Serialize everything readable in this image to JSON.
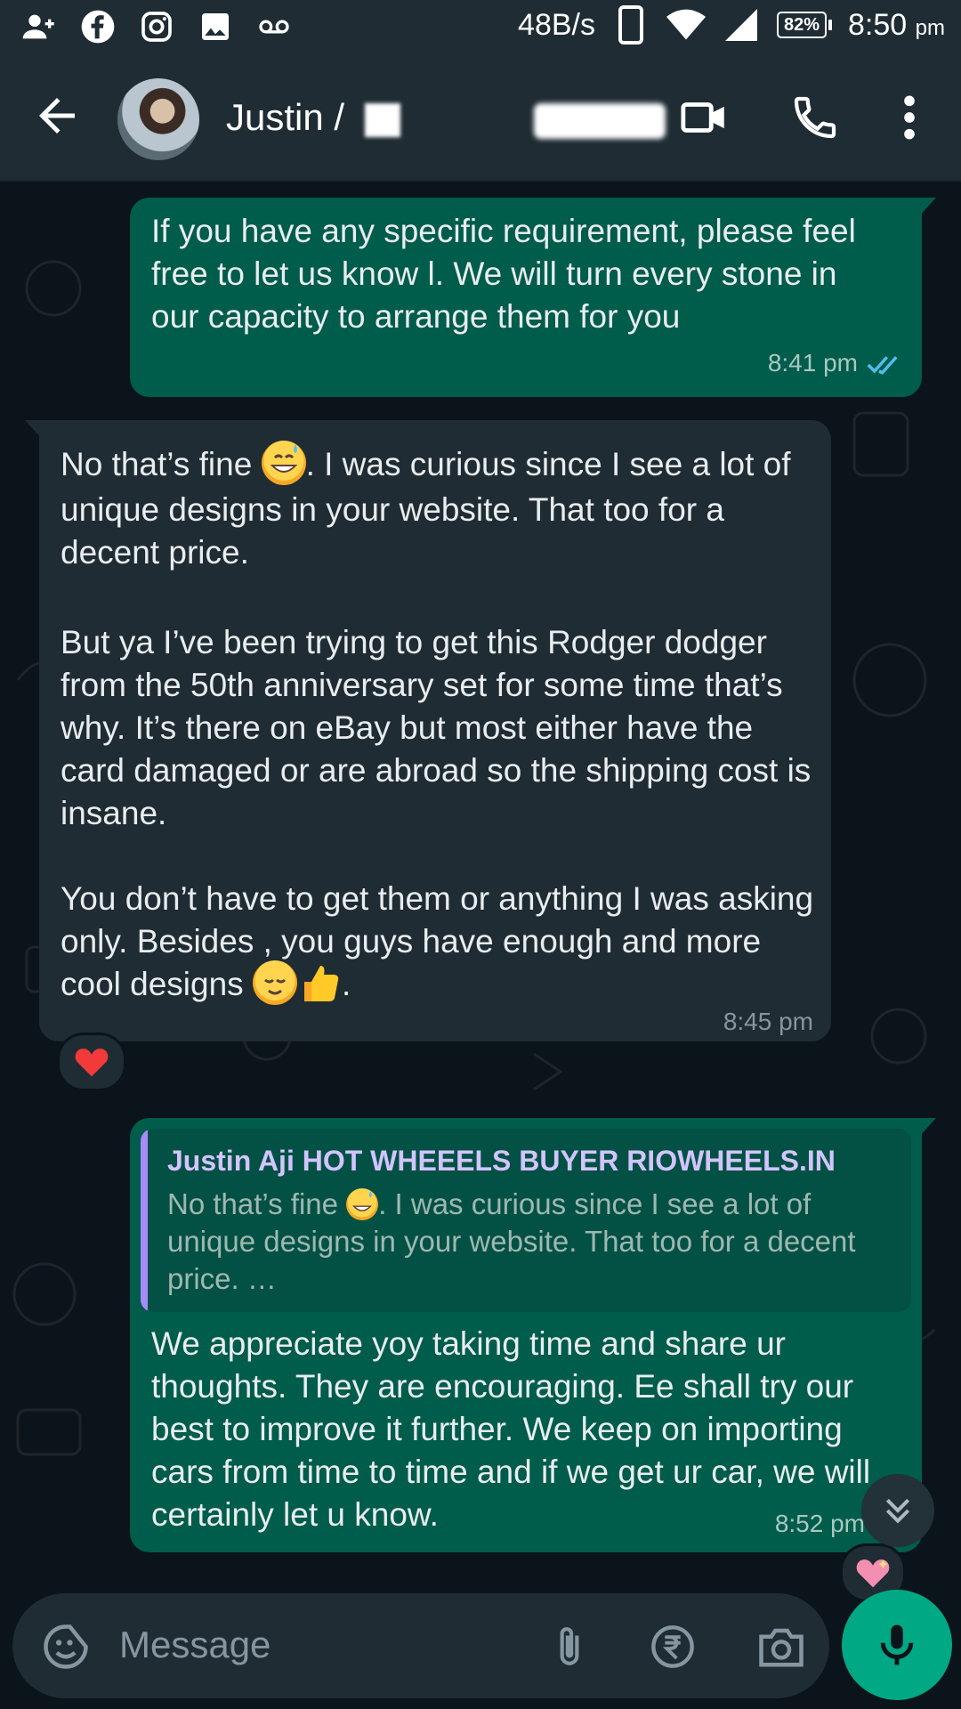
{
  "status_bar": {
    "net_speed": "48B/s",
    "battery": "82%",
    "time": "8:50",
    "time_suffix": "pm"
  },
  "header": {
    "contact_name": "Justin /"
  },
  "messages": [
    {
      "direction": "outgoing",
      "text": "If you have any specific requirement, please feel free to let us know l. We will turn every stone in our capacity to arrange them for you",
      "time": "8:41 pm",
      "status": "read"
    },
    {
      "direction": "incoming",
      "p1_a": "No that’s fine ",
      "p1_b": ". I was curious since I see a lot of unique designs in your website. That too for a decent price.",
      "p2": "But ya I’ve been trying to get this Rodger dodger from the 50th anniversary set for some time that’s why. It’s there on eBay but most either have the card damaged or are abroad so the shipping cost is insane.",
      "p3": "You don’t have to get them or anything I was asking only. Besides , you guys have enough and more cool designs ",
      "p3_end": ".",
      "time": "8:45 pm",
      "reaction": "red-heart"
    },
    {
      "direction": "outgoing",
      "quote_name": "Justin Aji HOT WHEEELS BUYER RIOWHEELS.IN",
      "quote_text_a": "No that’s fine ",
      "quote_text_b": ". I was curious since I see a lot of unique designs in your website. That too for a decent price. …",
      "text": "We appreciate yoy taking time and share ur thoughts. They are encouraging. Ee shall try our best to improve it further. We keep on importing cars from time to time and if we get ur car, we will certainly let u know.",
      "time": "8:52 pm",
      "reaction": "sparkling-heart"
    }
  ],
  "composer": {
    "placeholder": "Message"
  },
  "colors": {
    "outgoing_bubble": "#005c4b",
    "incoming_bubble": "#202c33",
    "accent": "#00a884",
    "read_ticks": "#53bdeb"
  }
}
